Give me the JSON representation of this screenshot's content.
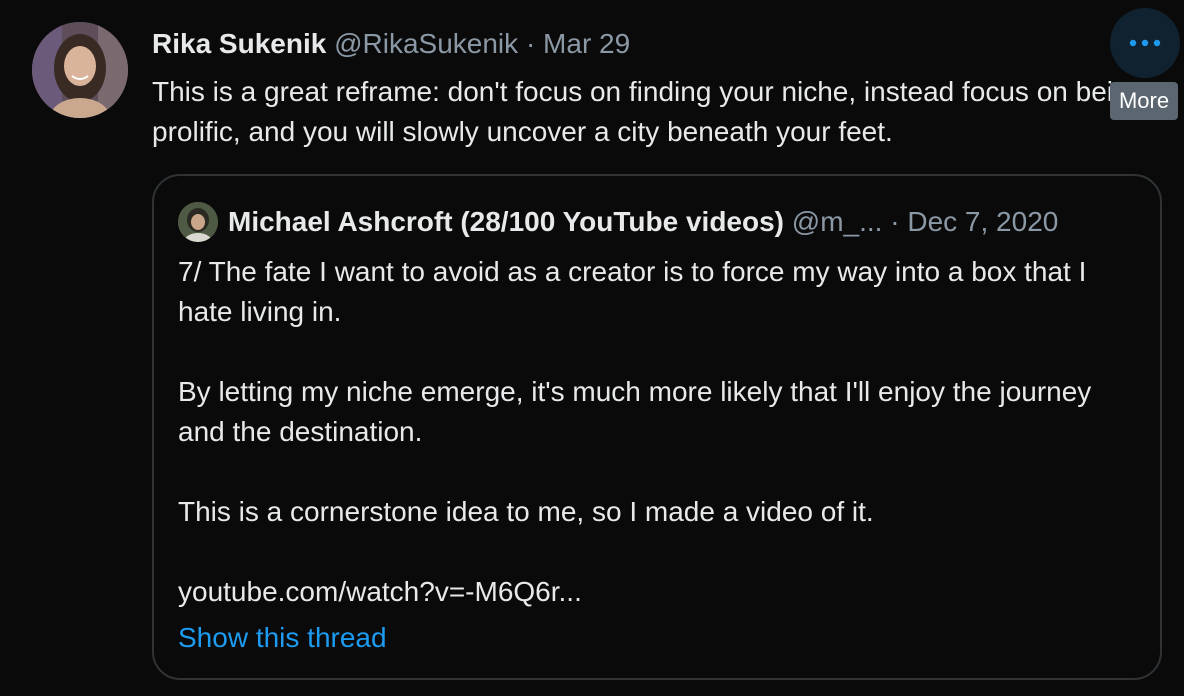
{
  "tweet": {
    "author_name": "Rika Sukenik",
    "author_handle": "@RikaSukenik",
    "separator": "·",
    "date": "Mar 29",
    "text": "This is a great reframe: don't focus on finding your niche, instead focus on being prolific, and you will slowly uncover a city beneath your feet.",
    "avatar_icon": "profile-photo",
    "more_icon": "more-dots-icon",
    "more_tooltip": "More"
  },
  "quoted_tweet": {
    "author_name": "Michael Ashcroft (28/100 YouTube videos)",
    "author_handle": "@m_...",
    "separator": "·",
    "date": "Dec 7, 2020",
    "paragraphs": [
      "7/ The fate I want to avoid as a creator is to force my way into a box that I hate living in.",
      "By letting my niche emerge, it's much more likely that I'll enjoy the journey and the destination.",
      "This is a cornerstone idea to me, so I made a video of it.",
      "youtube.com/watch?v=-M6Q6r..."
    ],
    "show_thread_label": "Show this thread"
  },
  "colors": {
    "background": "#0a0a0a",
    "text": "#e7e9ea",
    "muted": "#8b98a5",
    "link": "#1d9bf0",
    "border": "#2f3336"
  }
}
